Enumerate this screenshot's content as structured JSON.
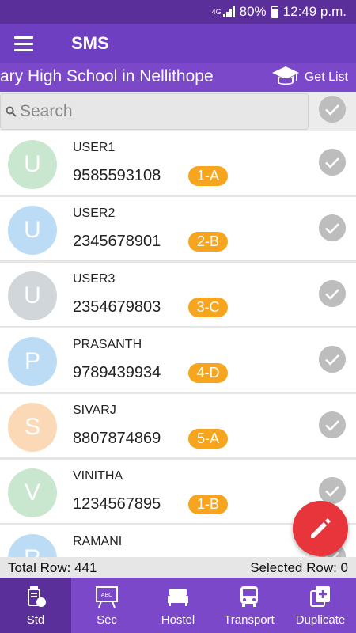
{
  "status_bar": {
    "network": "4G",
    "battery": "80%",
    "time": "12:49 p.m."
  },
  "app_bar": {
    "title": "SMS"
  },
  "school_bar": {
    "school_name": "ary High School in Nellithope",
    "get_list_label": "Get List"
  },
  "search": {
    "placeholder": "Search",
    "value": ""
  },
  "contacts": [
    {
      "initial": "U",
      "name": "USER1",
      "phone": "9585593108",
      "class": "1-A",
      "avatar_color": "#c9e6cf"
    },
    {
      "initial": "U",
      "name": "USER2",
      "phone": "2345678901",
      "class": "2-B",
      "avatar_color": "#bcdcf6"
    },
    {
      "initial": "U",
      "name": "USER3",
      "phone": "2354679803",
      "class": "3-C",
      "avatar_color": "#d1d6da"
    },
    {
      "initial": "P",
      "name": "PRASANTH",
      "phone": "9789439934",
      "class": "4-D",
      "avatar_color": "#bcdcf6"
    },
    {
      "initial": "S",
      "name": "SIVARJ",
      "phone": "8807874869",
      "class": "5-A",
      "avatar_color": "#fbd9b6"
    },
    {
      "initial": "V",
      "name": "VINITHA",
      "phone": "1234567895",
      "class": "1-B",
      "avatar_color": "#c9e6cf"
    },
    {
      "initial": "R",
      "name": "RAMANI",
      "phone": "",
      "class": "",
      "avatar_color": "#bcdcf6"
    }
  ],
  "totals": {
    "total_label": "Total Row: 441",
    "selected_label": "Selected Row: 0"
  },
  "bottom_nav": [
    {
      "label": "Std",
      "icon": "student-icon",
      "active": true
    },
    {
      "label": "Sec",
      "icon": "board-icon",
      "active": false
    },
    {
      "label": "Hostel",
      "icon": "bed-icon",
      "active": false
    },
    {
      "label": "Transport",
      "icon": "bus-icon",
      "active": false
    },
    {
      "label": "Duplicate",
      "icon": "duplicate-icon",
      "active": false
    }
  ],
  "colors": {
    "status_bar": "#5b2f9a",
    "app_bar": "#6f3fc2",
    "accent": "#7b48c9",
    "badge": "#f7a51e",
    "fab": "#e8343b",
    "check": "#bdbdbd"
  }
}
